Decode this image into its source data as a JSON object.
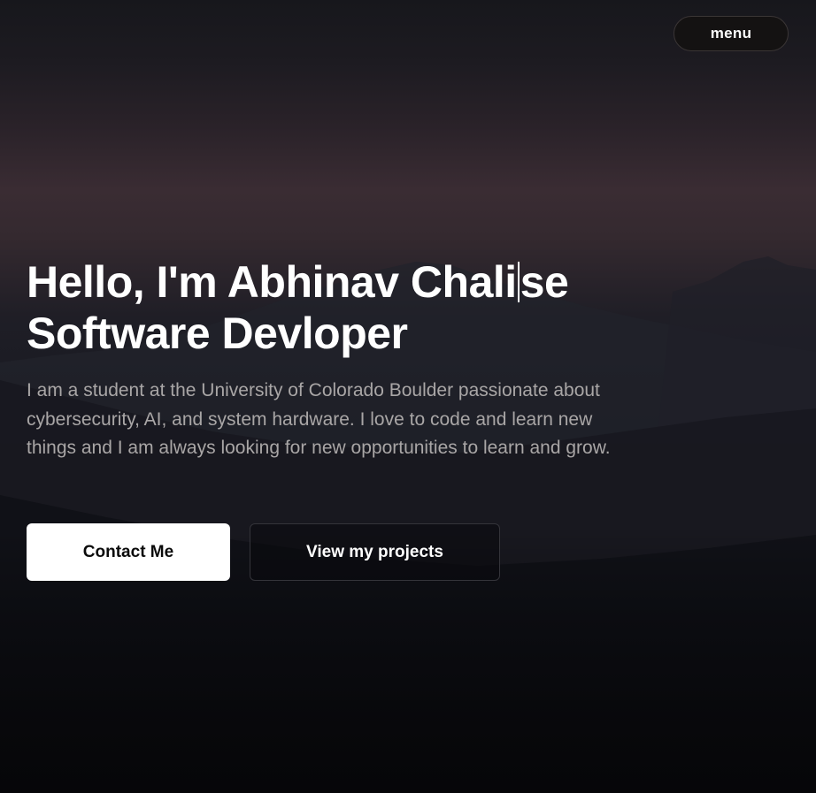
{
  "header": {
    "menu_label": "menu"
  },
  "hero": {
    "headline_line1_before_caret": "Hello, I'm Abhinav Chali",
    "headline_line1_after_caret": "se",
    "headline_line2": "Software Devloper",
    "bio": "I am a student at the University of Colorado Boulder passionate about cybersecurity, AI, and system hardware. I love to code and learn new things and I am always looking for new opportunities to learn and grow.",
    "primary_button_label": "Contact Me",
    "secondary_button_label": "View my projects"
  },
  "colors": {
    "background": "#0c0c10",
    "sky_glow": "#3a2c33",
    "headline_text": "#ffffff",
    "bio_text": "#a9a6a6",
    "primary_button_bg": "#ffffff",
    "secondary_button_border": "#34343a"
  }
}
